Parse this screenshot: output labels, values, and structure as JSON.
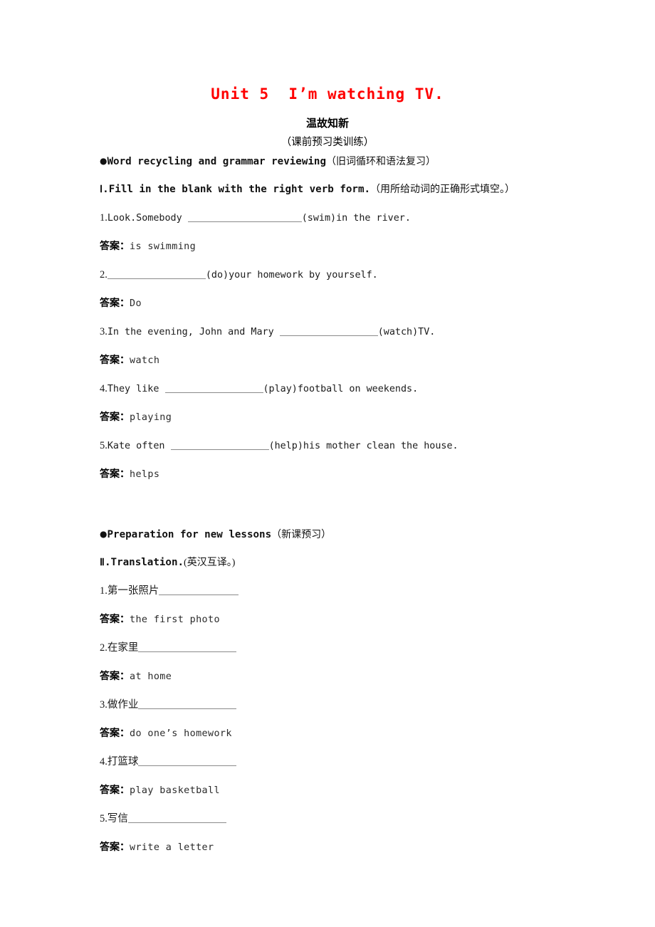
{
  "document": {
    "title": "Unit 5  I’m watching TV.",
    "title_color": "#ff0000",
    "subtitle": "温故知新",
    "subtitle_note": "（课前预习类训练）"
  },
  "sections": [
    {
      "bullet": "●",
      "heading_en": "Word recycling and grammar reviewing",
      "heading_cn": "（旧词循环和语法复习）",
      "exercise_number": "Ⅰ.",
      "exercise_en": "Fill in the blank with the right verb form.",
      "exercise_cn": "（用所给动词的正确形式填空。）",
      "answer_label": "答案：",
      "items": [
        {
          "number": "1.",
          "pre": "Look.Somebody ",
          "post": "(swim)in the river.",
          "answer": "is swimming"
        },
        {
          "number": "2.",
          "pre": "",
          "post": "(do)your homework by yourself.",
          "answer": "Do"
        },
        {
          "number": "3.",
          "pre": "In the evening, John and Mary ",
          "post": "(watch)TV.",
          "answer": "watch"
        },
        {
          "number": "4.",
          "pre": "They like ",
          "post": "(play)football on weekends.",
          "answer": "playing"
        },
        {
          "number": "5.",
          "pre": "Kate often ",
          "post": "(help)his mother clean the house.",
          "answer": "helps"
        }
      ]
    },
    {
      "bullet": "●",
      "heading_en": "Preparation for new lessons",
      "heading_cn": "（新课预习）",
      "exercise_number": "Ⅱ.",
      "exercise_en": "Translation.",
      "exercise_cn": "(英汉互译。)",
      "answer_label": "答案：",
      "items": [
        {
          "number": "1.",
          "pre": "第一张照片",
          "post": "",
          "answer": "the first photo"
        },
        {
          "number": "2.",
          "pre": "在家里",
          "post": "",
          "answer": "at home"
        },
        {
          "number": "3.",
          "pre": "做作业",
          "post": "",
          "answer": "do one’s homework"
        },
        {
          "number": "4.",
          "pre": "打篮球",
          "post": "",
          "answer": "play basketball"
        },
        {
          "number": "5.",
          "pre": "写信",
          "post": "",
          "answer": "write a letter"
        }
      ]
    }
  ]
}
